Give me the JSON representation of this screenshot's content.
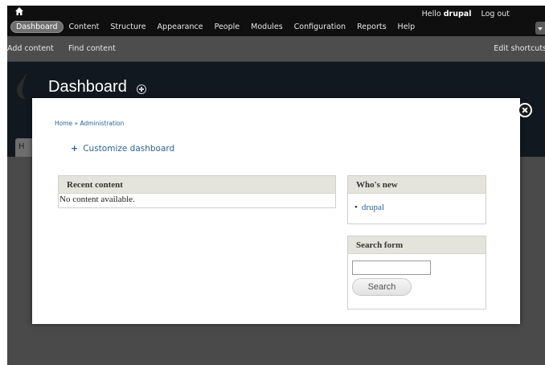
{
  "toolbar": {
    "tabs": [
      {
        "label": "Dashboard",
        "active": true
      },
      {
        "label": "Content"
      },
      {
        "label": "Structure"
      },
      {
        "label": "Appearance"
      },
      {
        "label": "People"
      },
      {
        "label": "Modules"
      },
      {
        "label": "Configuration"
      },
      {
        "label": "Reports"
      },
      {
        "label": "Help"
      }
    ],
    "hello": "Hello",
    "username": "drupal",
    "logout": "Log out"
  },
  "shortcuts": {
    "add_content": "Add content",
    "find_content": "Find content",
    "edit_shortcuts": "Edit shortcuts"
  },
  "header": {
    "title": "Dashboard",
    "ghost": "Drupal",
    "hidden_tab": "H"
  },
  "dialog": {
    "breadcrumb": "Home » Administration",
    "customize_label": "Customize dashboard",
    "recent": {
      "title": "Recent content",
      "empty": "No content available."
    },
    "whos_new": {
      "title": "Who's new",
      "users": [
        "drupal"
      ]
    },
    "search_form": {
      "title": "Search form",
      "input_value": "",
      "button_label": "Search"
    }
  },
  "colors": {
    "toolbar_bg": "#0f0f0f",
    "header_bg": "#121820",
    "link": "#2a6496",
    "block_head": "#e4e4dc"
  }
}
